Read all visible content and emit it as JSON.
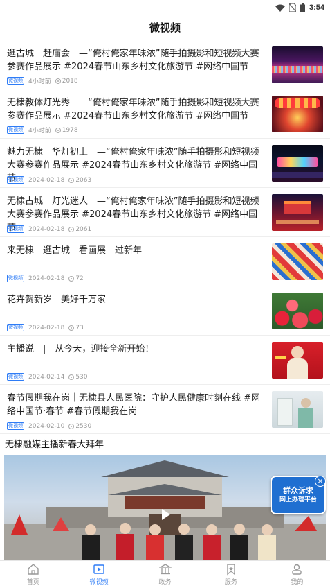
{
  "status_bar": {
    "time": "3:54"
  },
  "header": {
    "title": "微视频"
  },
  "news": [
    {
      "title": "逛古城　赶庙会　—“俺村俺家年味浓”随手拍摄影和短视频大赛参赛作品展示 #2024春节山东乡村文化旅游节 #网络中国节",
      "tag": "微视频",
      "time": "4小时前",
      "views": "2018"
    },
    {
      "title": "无棣教体灯光秀　—“俺村俺家年味浓”随手拍摄影和短视频大赛参赛作品展示 #2024春节山东乡村文化旅游节 #网络中国节",
      "tag": "微视频",
      "time": "4小时前",
      "views": "1978"
    },
    {
      "title": "魅力无棣　华灯初上　—“俺村俺家年味浓”随手拍摄影和短视频大赛参赛作品展示 #2024春节山东乡村文化旅游节 #网络中国节",
      "tag": "微视频",
      "time": "2024-02-18",
      "views": "2063"
    },
    {
      "title": "无棣古城　灯光迷人　—“俺村俺家年味浓”随手拍摄影和短视频大赛参赛作品展示 #2024春节山东乡村文化旅游节 #网络中国节",
      "tag": "微视频",
      "time": "2024-02-18",
      "views": "2061"
    },
    {
      "title": "来无棣　逛古城　看画展　过新年",
      "tag": "微视频",
      "time": "2024-02-18",
      "views": "72"
    },
    {
      "title": "花卉贺新岁　美好千万家",
      "tag": "微视频",
      "time": "2024-02-18",
      "views": "73"
    },
    {
      "title": "主播说　|　从今天，迎接全新开始！",
      "tag": "微视频",
      "time": "2024-02-14",
      "views": "530"
    },
    {
      "title": "春节假期我在岗｜无棣县人民医院：守护人民健康时刻在线 #网络中国节·春节 #春节假期我在岗",
      "tag": "微视频",
      "time": "2024-02-10",
      "views": "2530"
    }
  ],
  "featured": {
    "title": "无棣融媒主播新春大拜年"
  },
  "float_ad": {
    "line1": "群众诉求",
    "line2": "网上办理平台"
  },
  "tabs": [
    {
      "label": "首页",
      "icon": "home-icon"
    },
    {
      "label": "微视频",
      "icon": "video-icon"
    },
    {
      "label": "政务",
      "icon": "government-icon"
    },
    {
      "label": "服务",
      "icon": "bookmark-icon"
    },
    {
      "label": "我的",
      "icon": "user-icon"
    }
  ],
  "colors": {
    "accent": "#2e7cf6",
    "ad_blue": "#1f6fd1"
  }
}
